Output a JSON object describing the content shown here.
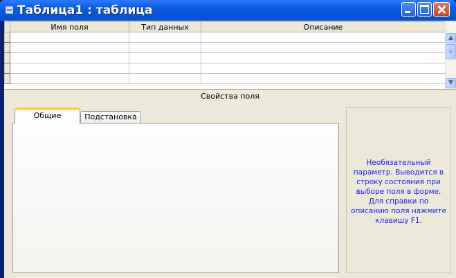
{
  "window": {
    "title": "Таблица1 : таблица"
  },
  "grid": {
    "columns": [
      "Имя поля",
      "Тип данных",
      "Описание"
    ],
    "row_count": 5
  },
  "field_properties": {
    "header": "Свойства поля",
    "tabs": [
      "Общие",
      "Подстановка"
    ],
    "active_tab": "Общие"
  },
  "help": {
    "lines": [
      "Необязательный",
      "параметр. Выводится в",
      "строку состояния при",
      "выборе поля в форме.",
      "Для справки по",
      "описанию поля нажмите",
      "клавишу F1."
    ]
  },
  "colors": {
    "titlebar": "#0a5ee8",
    "help_text": "#1a1aff",
    "active_tab_accent": "#ffc83c"
  }
}
